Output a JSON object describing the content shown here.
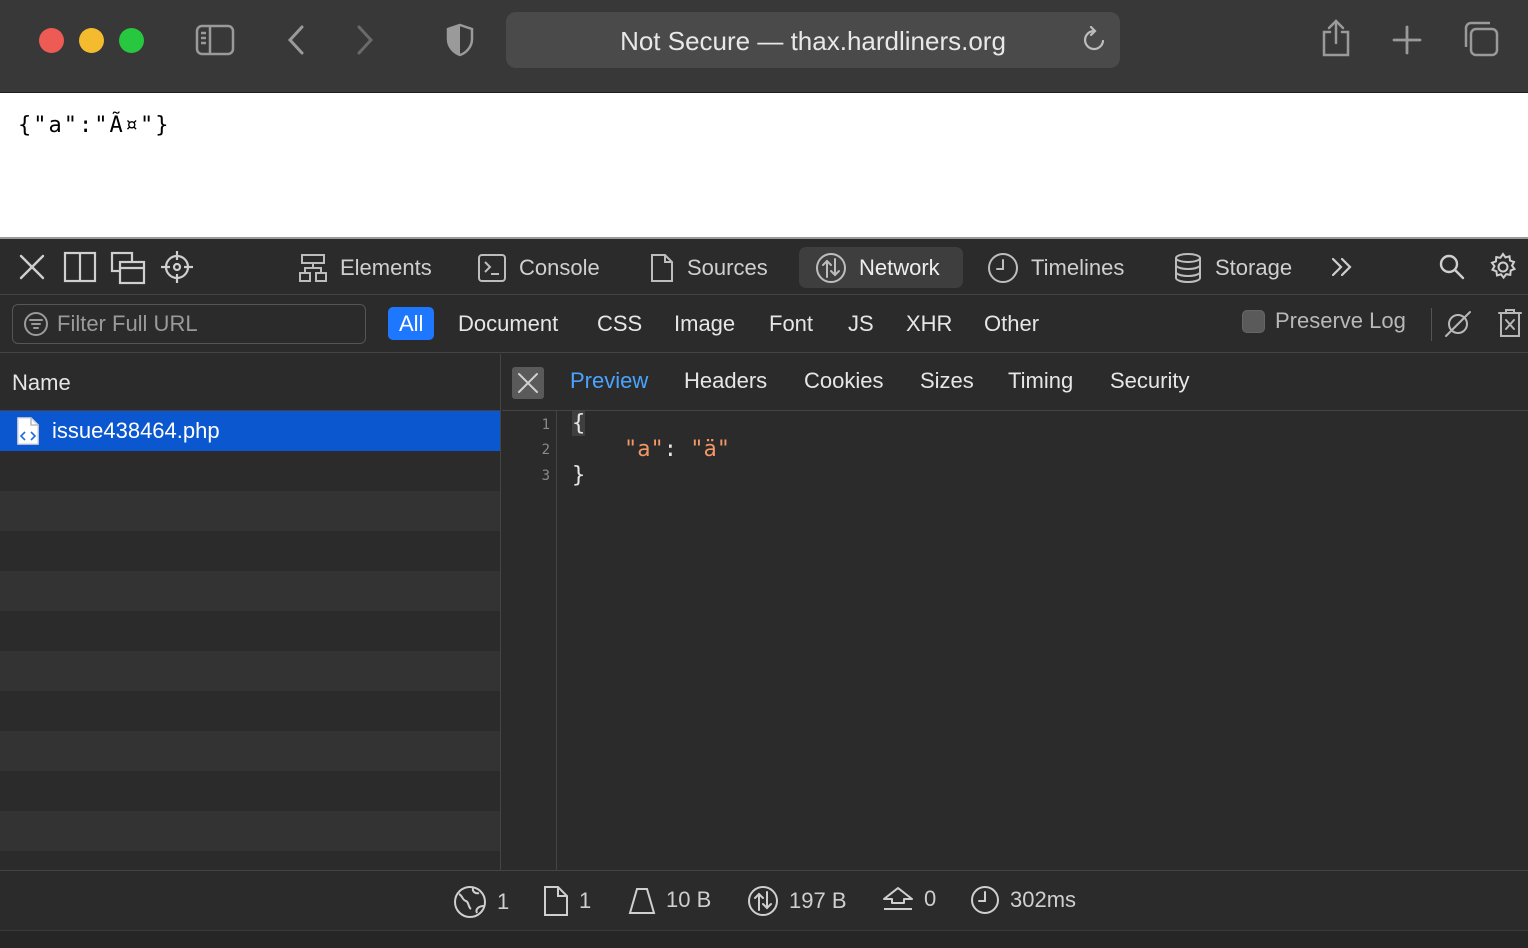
{
  "browser": {
    "address": "Not Secure — thax.hardliners.org",
    "colors": {
      "close": "#ee5b55",
      "minimize": "#f5bb2e",
      "zoom": "#27c840"
    }
  },
  "page": {
    "body_text": "{\"a\":\"Ã¤\"}"
  },
  "devtools": {
    "tabs": [
      {
        "label": "Elements",
        "icon": "elements-icon"
      },
      {
        "label": "Console",
        "icon": "console-icon"
      },
      {
        "label": "Sources",
        "icon": "document-icon"
      },
      {
        "label": "Network",
        "icon": "network-icon",
        "active": true
      },
      {
        "label": "Timelines",
        "icon": "clock-icon"
      },
      {
        "label": "Storage",
        "icon": "database-icon"
      }
    ],
    "filter": {
      "placeholder": "Filter Full URL",
      "types": [
        "All",
        "Document",
        "CSS",
        "Image",
        "Font",
        "JS",
        "XHR",
        "Other"
      ],
      "active_type": "All",
      "preserve_log": "Preserve Log"
    },
    "name_column": "Name",
    "requests": [
      {
        "name": "issue438464.php",
        "selected": true
      }
    ],
    "detail_tabs": [
      "Preview",
      "Headers",
      "Cookies",
      "Sizes",
      "Timing",
      "Security"
    ],
    "active_detail_tab": "Preview",
    "preview": {
      "line_numbers": [
        "1",
        "2",
        "3"
      ],
      "open": "{",
      "key": "\"a\"",
      "colon": ": ",
      "value": "\"ä\"",
      "close": "}"
    },
    "status": {
      "resources": "1",
      "documents": "1",
      "transferred": "10 B",
      "size": "197 B",
      "redirects": "0",
      "time": "302ms"
    }
  }
}
